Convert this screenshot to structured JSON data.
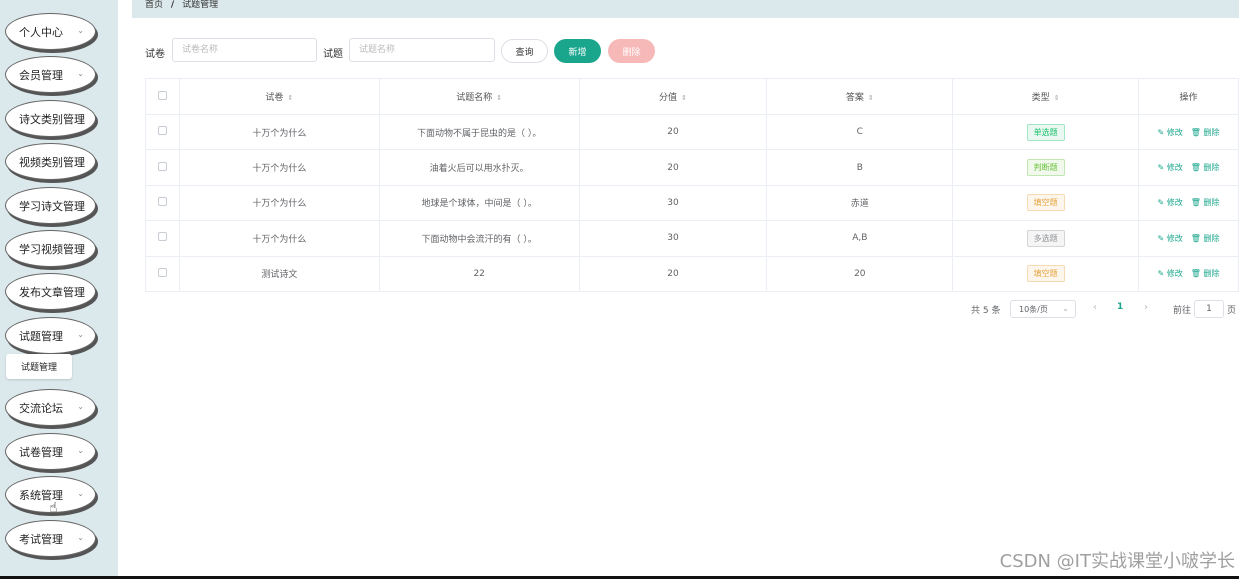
{
  "sidebar": {
    "items": [
      {
        "label": "个人中心",
        "chevron": true
      },
      {
        "label": "会员管理",
        "chevron": true
      },
      {
        "label": "诗文类别管理",
        "chevron": false
      },
      {
        "label": "视频类别管理",
        "chevron": false
      },
      {
        "label": "学习诗文管理",
        "chevron": false
      },
      {
        "label": "学习视频管理",
        "chevron": false
      },
      {
        "label": "发布文章管理",
        "chevron": false
      },
      {
        "label": "试题管理",
        "chevron": true
      },
      {
        "label": "交流论坛",
        "chevron": true
      },
      {
        "label": "试卷管理",
        "chevron": true
      },
      {
        "label": "系统管理",
        "chevron": true
      },
      {
        "label": "考试管理",
        "chevron": true
      }
    ],
    "submenu_label": "试题管理"
  },
  "breadcrumb": {
    "home": "首页",
    "sep": "/",
    "current": "试题管理"
  },
  "search": {
    "paper_label": "试卷",
    "paper_placeholder": "试卷名称",
    "question_label": "试题",
    "question_placeholder": "试题名称",
    "query_button": "查询",
    "add_button": "新增",
    "delete_button": "删除"
  },
  "table": {
    "headers": [
      "试卷",
      "试题名称",
      "分值",
      "答案",
      "类型",
      "操作"
    ],
    "rows": [
      {
        "paper": "十万个为什么",
        "question": "下面动物不属于昆虫的是（ ）。",
        "score": "20",
        "answer": "C",
        "type": "单选题",
        "type_color": "#19be6b"
      },
      {
        "paper": "十万个为什么",
        "question": "油着火后可以用水扑灭。",
        "score": "20",
        "answer": "B",
        "type": "判断题",
        "type_color": "#67c23a"
      },
      {
        "paper": "十万个为什么",
        "question": "地球是个球体，中间是（ ）。",
        "score": "30",
        "answer": "赤道",
        "type": "填空题",
        "type_color": "#e6a23c"
      },
      {
        "paper": "十万个为什么",
        "question": "下面动物中会流汗的有（ ）。",
        "score": "30",
        "answer": "A,B",
        "type": "多选题",
        "type_color": "#909399"
      },
      {
        "paper": "测试诗文",
        "question": "22",
        "score": "20",
        "answer": "20",
        "type": "填空题",
        "type_color": "#e6a23c"
      }
    ],
    "edit_label": "修改",
    "delete_label": "删除"
  },
  "pagination": {
    "total": "共 5 条",
    "page_size": "10条/页",
    "current_page": "1",
    "goto_prefix": "前往",
    "goto_value": "1",
    "goto_suffix": "页"
  },
  "watermark": "CSDN @IT实战课堂小啵学长",
  "colors": {
    "accent": "#1aa68c",
    "sidebar_bg": "#dbe8ec",
    "delete_btn": "#f7b8b8"
  }
}
